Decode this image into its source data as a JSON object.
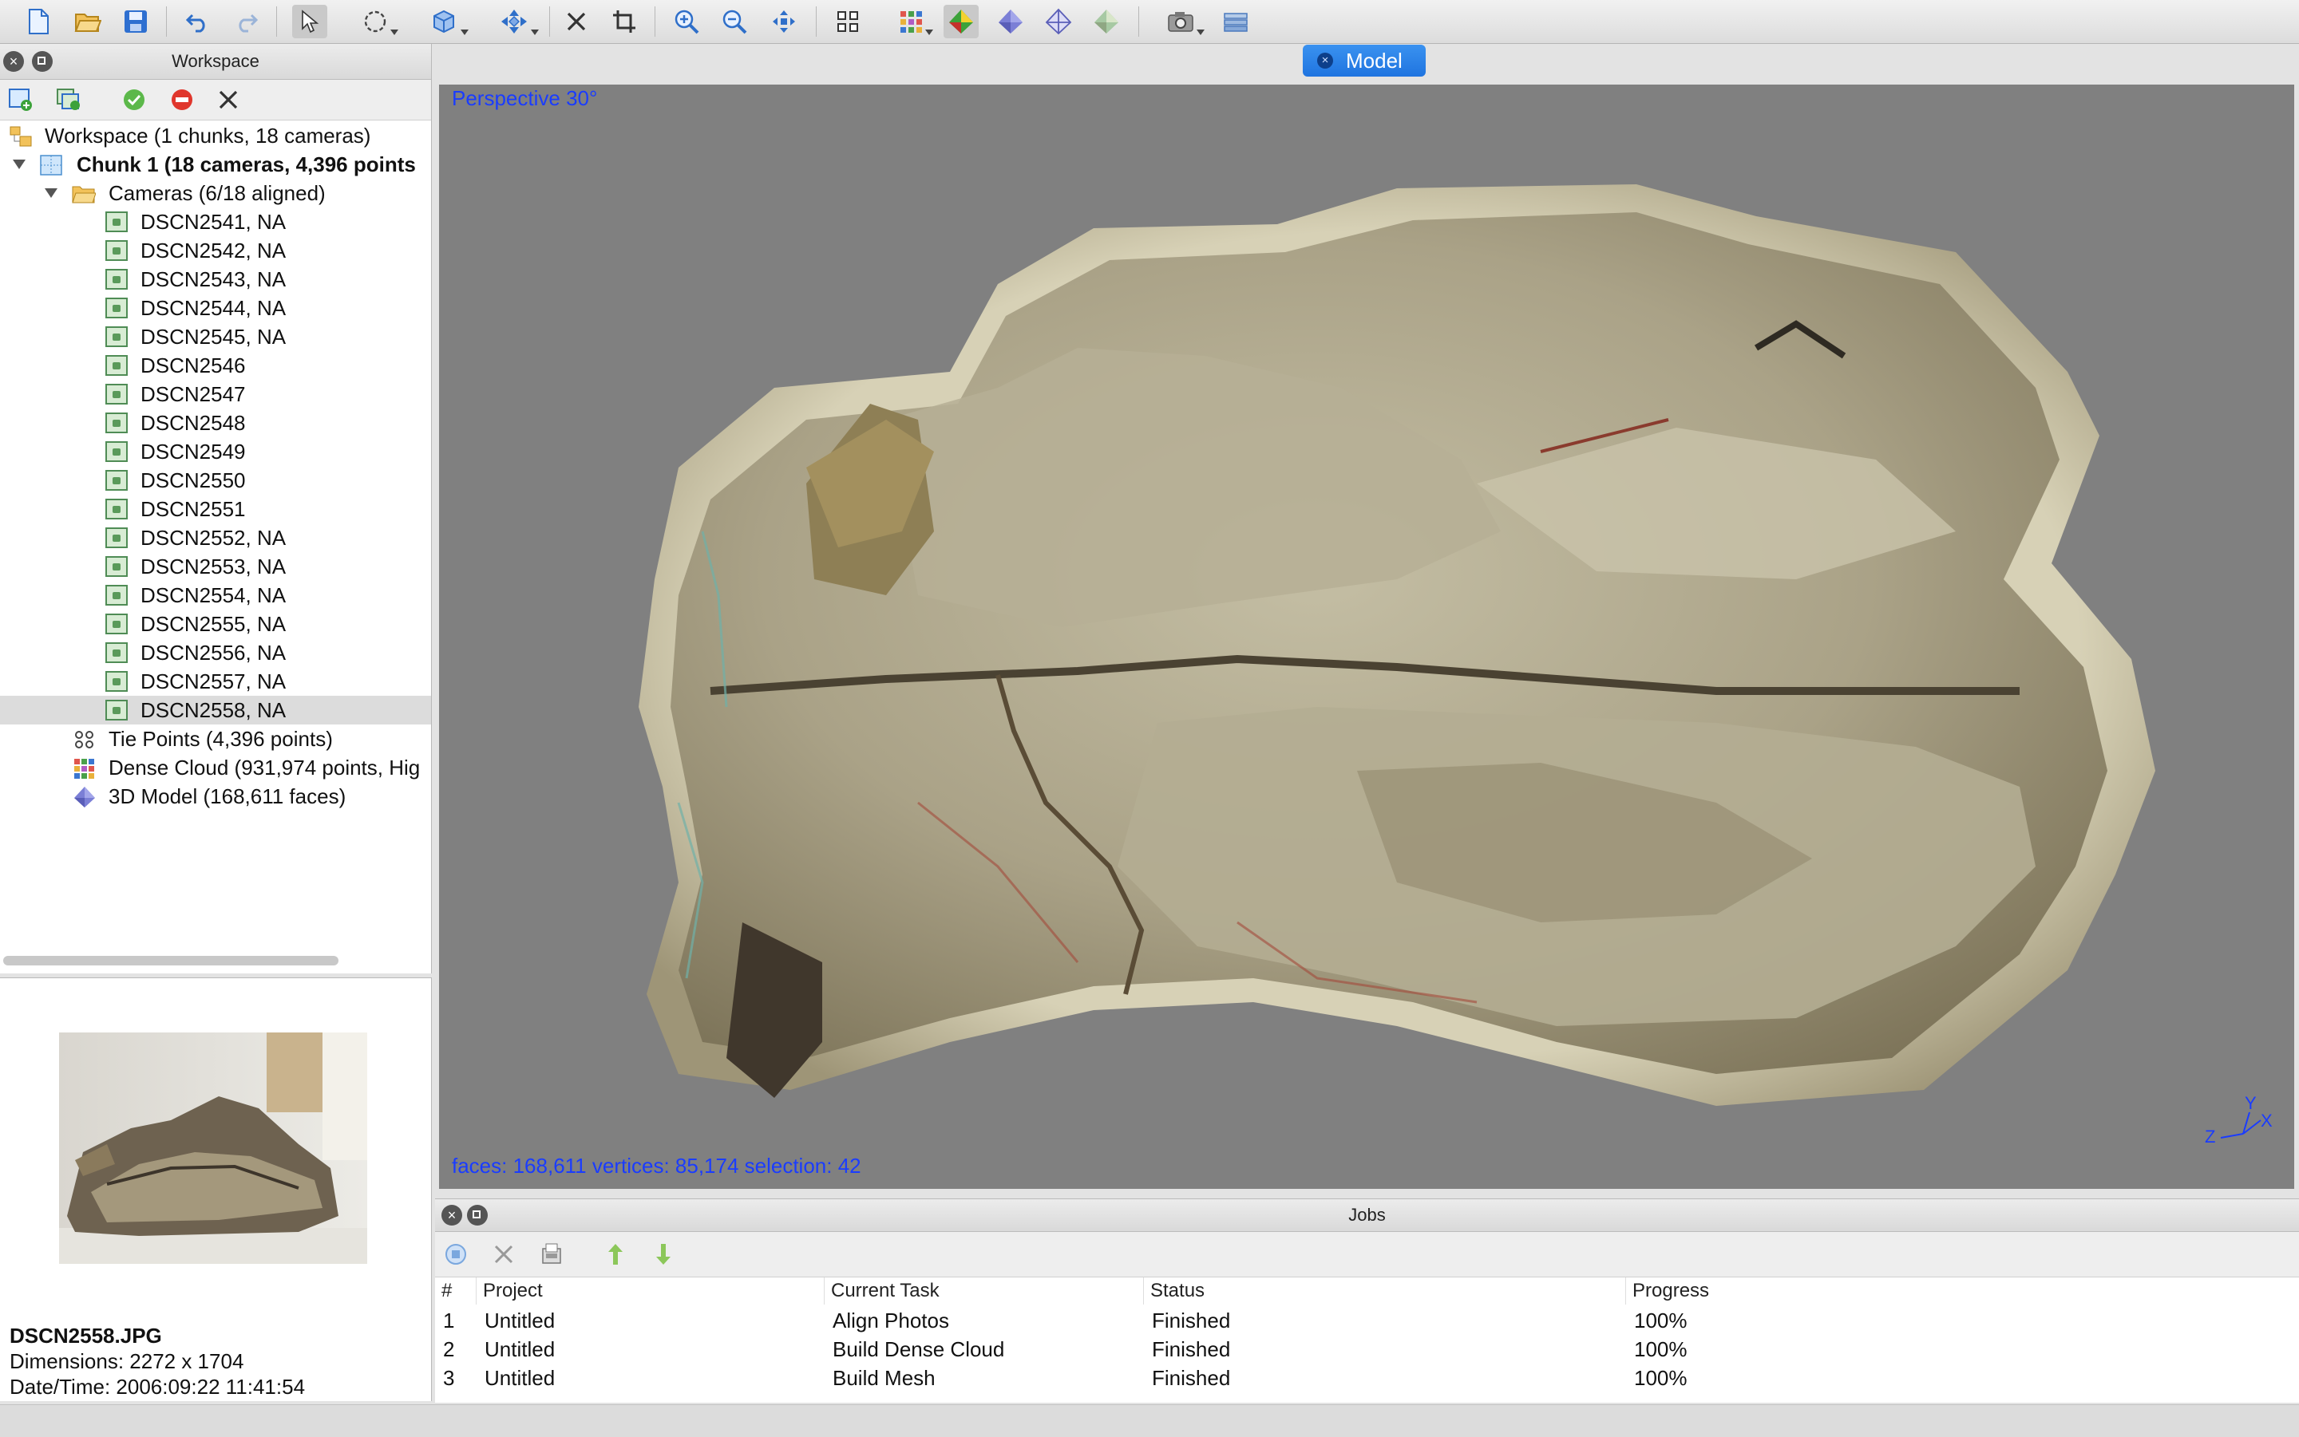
{
  "workspace": {
    "title": "Workspace",
    "tree": {
      "root": "Workspace (1 chunks, 18 cameras)",
      "chunk": "Chunk 1 (18 cameras, 4,396 points",
      "cameras_folder": "Cameras (6/18 aligned)",
      "cameras": [
        "DSCN2541, NA",
        "DSCN2542, NA",
        "DSCN2543, NA",
        "DSCN2544, NA",
        "DSCN2545, NA",
        "DSCN2546",
        "DSCN2547",
        "DSCN2548",
        "DSCN2549",
        "DSCN2550",
        "DSCN2551",
        "DSCN2552, NA",
        "DSCN2553, NA",
        "DSCN2554, NA",
        "DSCN2555, NA",
        "DSCN2556, NA",
        "DSCN2557, NA",
        "DSCN2558, NA"
      ],
      "tie_points": "Tie Points (4,396 points)",
      "dense_cloud": "Dense Cloud (931,974 points, Hig",
      "model": "3D Model (168,611 faces)"
    }
  },
  "preview": {
    "filename": "DSCN2558.JPG",
    "dimensions": "Dimensions: 2272 x 1704",
    "datetime": "Date/Time: 2006:09:22 11:41:54"
  },
  "model_view": {
    "tab_label": "Model",
    "projection": "Perspective 30°",
    "stats": "faces: 168,611 vertices: 85,174 selection: 42",
    "axes": {
      "x": "X",
      "y": "Y",
      "z": "Z"
    }
  },
  "jobs": {
    "title": "Jobs",
    "columns": [
      "#",
      "Project",
      "Current Task",
      "Status",
      "Progress"
    ],
    "rows": [
      [
        "1",
        "Untitled",
        "Align Photos",
        "Finished",
        "100%"
      ],
      [
        "2",
        "Untitled",
        "Build Dense Cloud",
        "Finished",
        "100%"
      ],
      [
        "3",
        "Untitled",
        "Build Mesh",
        "Finished",
        "100%"
      ]
    ]
  },
  "colors": {
    "accent": "#1f74e0",
    "viewport_bg": "#808080",
    "overlay_text": "#1a3cff"
  },
  "toolbar": {
    "icons": [
      "new-file-icon",
      "open-folder-icon",
      "save-icon",
      "undo-icon",
      "redo-icon",
      "navigation-icon",
      "rotate-selection-icon",
      "region-icon",
      "move-object-icon",
      "delete-icon",
      "crop-icon",
      "zoom-in-icon",
      "zoom-out-icon",
      "reset-view-icon",
      "show-cameras-icon",
      "point-cloud-icon",
      "model-shaded-icon",
      "model-solid-icon",
      "model-wireframe-icon",
      "model-textured-icon",
      "capture-view-icon",
      "ortho-icon"
    ]
  }
}
